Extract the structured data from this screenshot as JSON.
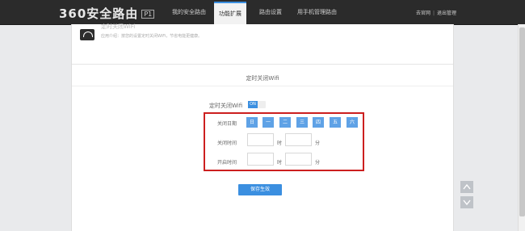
{
  "header": {
    "logo": "360安全路由",
    "version_badge": "P1",
    "nav": [
      "我的安全路由",
      "功能扩展",
      "路由设置",
      "用手机管理路由"
    ],
    "active_nav_index": 1,
    "links": {
      "forum": "去官网",
      "logout": "退出管理"
    }
  },
  "app": {
    "title": "定时关闭WiFi",
    "description": "应用介绍：按您的设置定时关闭WiFi，节省电能更健康。"
  },
  "section": {
    "title": "定时关闭Wifi",
    "toggle_label": "定时关闭Wifi",
    "toggle_state": "ON",
    "days_label": "关闭日期",
    "days": [
      "日",
      "一",
      "二",
      "三",
      "四",
      "五",
      "六"
    ],
    "close_time_label": "关闭时间",
    "open_time_label": "开启时间",
    "hour_unit": "时",
    "minute_unit": "分",
    "save_button": "保存生效"
  },
  "colors": {
    "accent": "#3b8fe0",
    "highlight_border": "#cc1f1f"
  }
}
